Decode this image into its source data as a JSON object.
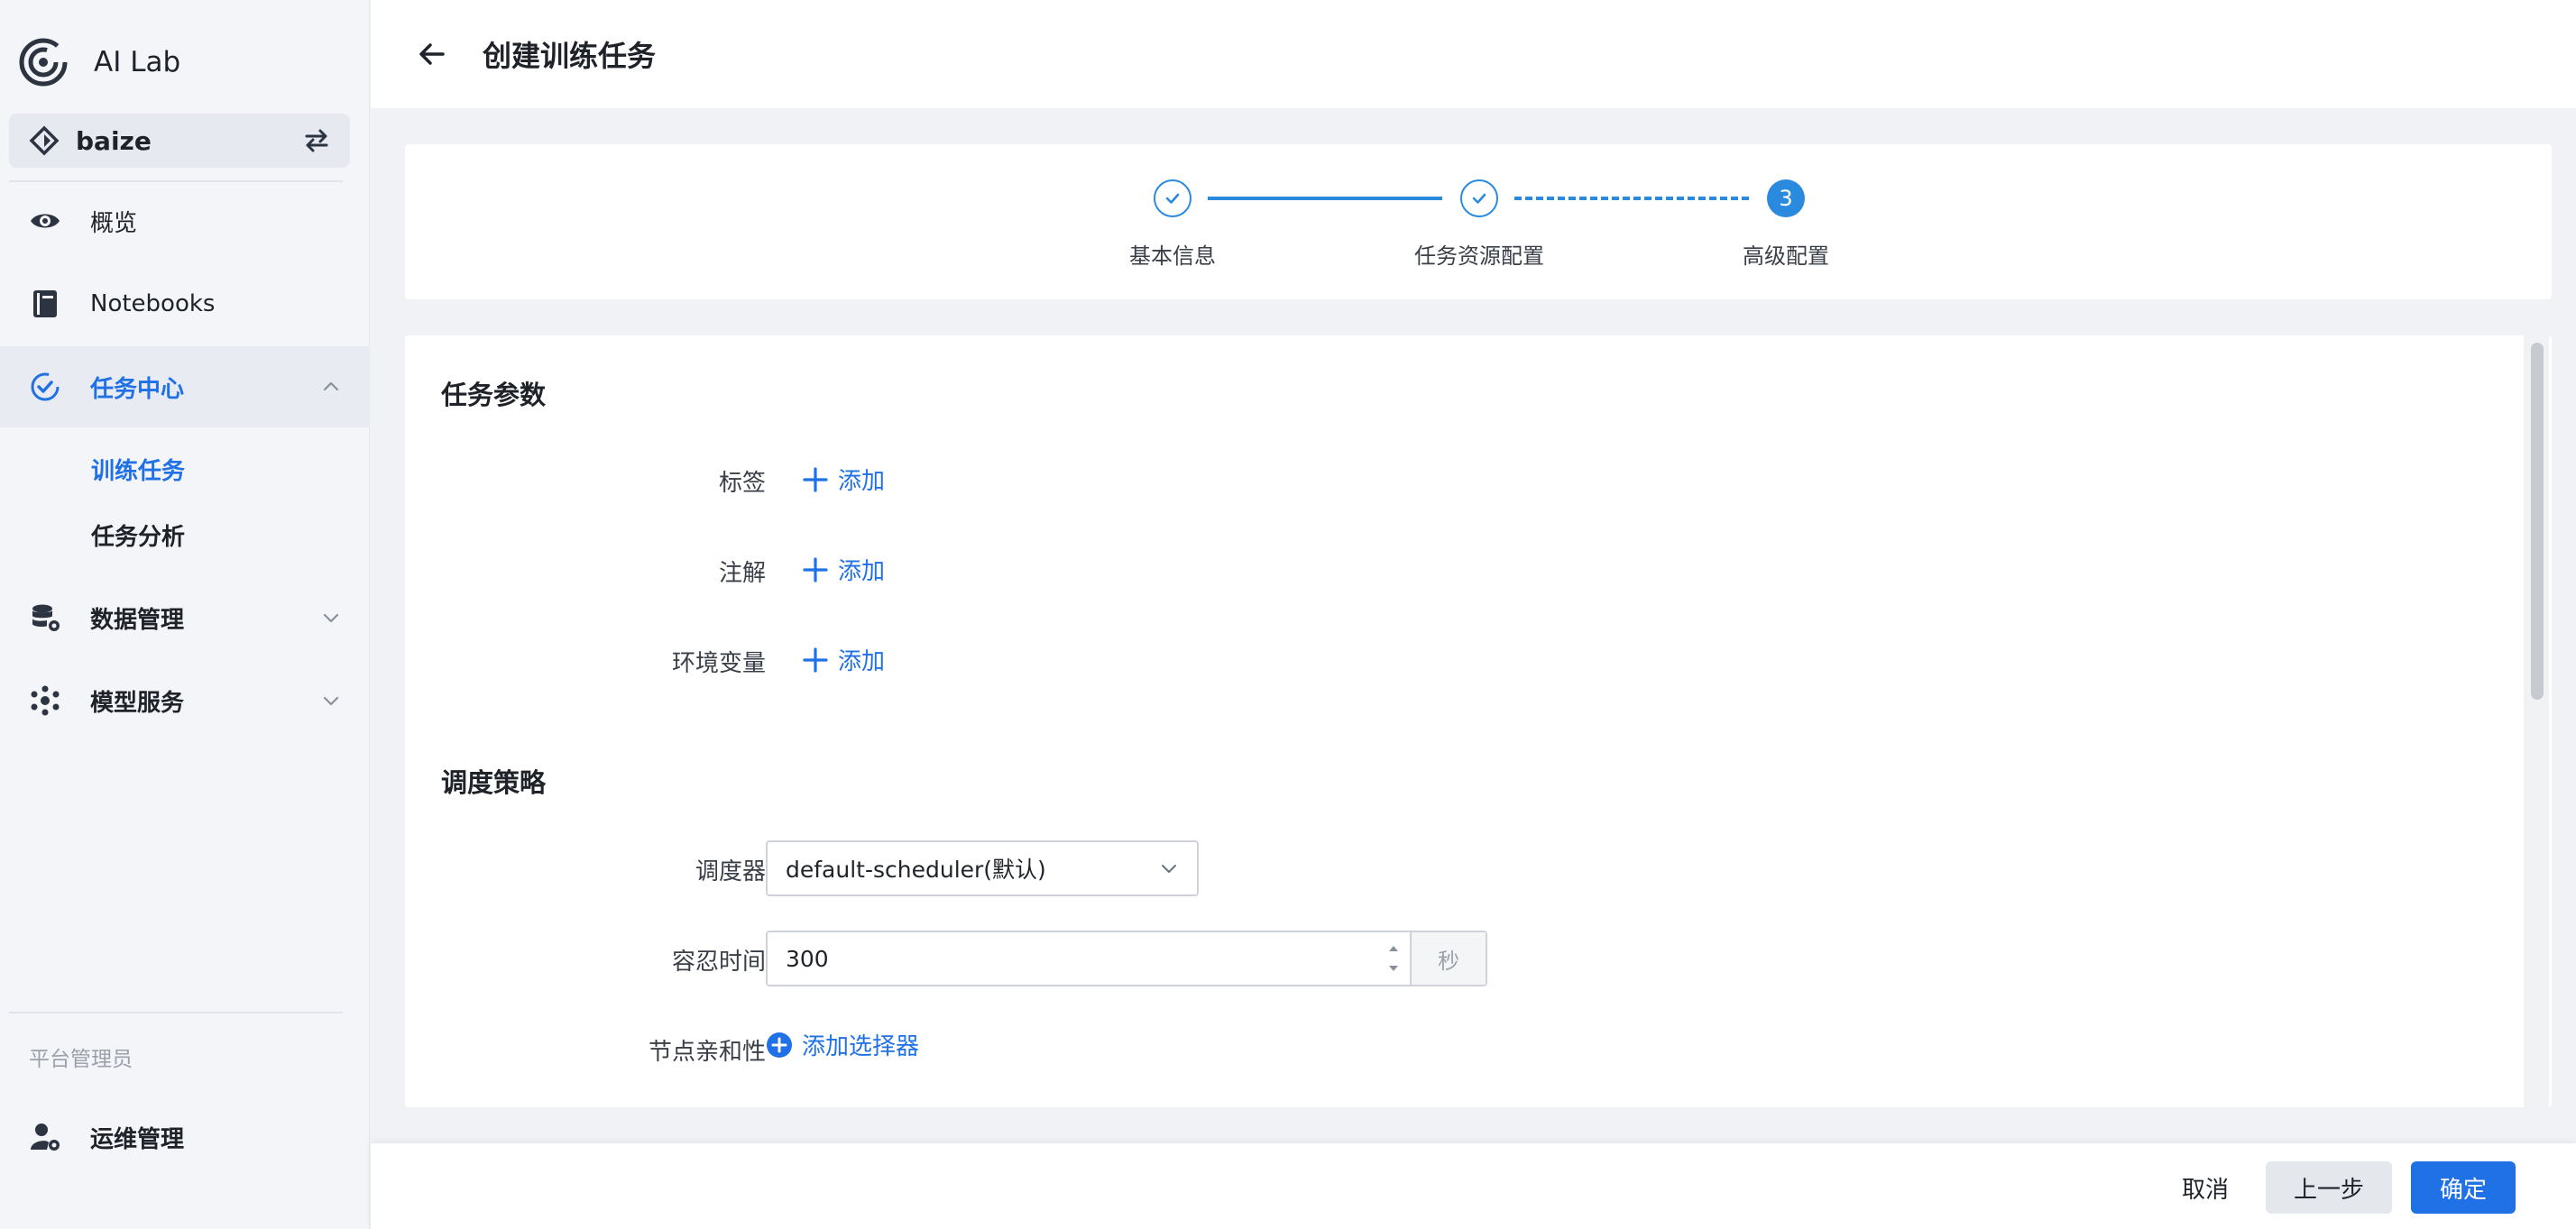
{
  "app": {
    "brand": "AI Lab",
    "workspace": "baize"
  },
  "colors": {
    "accent": "#2070e6",
    "step": "#2a8bde",
    "sidebar_bg": "#f4f5f8",
    "page_bg": "#f0f2f5"
  },
  "sidebar": {
    "items": [
      {
        "label": "概览",
        "icon": "eye-icon"
      },
      {
        "label": "Notebooks",
        "icon": "notebook-icon"
      },
      {
        "label": "任务中心",
        "icon": "task-check-icon",
        "active": true,
        "expanded": true,
        "children": [
          {
            "label": "训练任务",
            "active": true
          },
          {
            "label": "任务分析"
          }
        ]
      },
      {
        "label": "数据管理",
        "icon": "database-gear-icon"
      },
      {
        "label": "模型服务",
        "icon": "model-nodes-icon"
      }
    ],
    "section_caption": "平台管理员",
    "admin_item": {
      "label": "运维管理",
      "icon": "user-gear-icon"
    }
  },
  "header": {
    "title": "创建训练任务"
  },
  "steps": [
    {
      "label": "基本信息",
      "status": "done"
    },
    {
      "label": "任务资源配置",
      "status": "done"
    },
    {
      "label": "高级配置",
      "status": "current",
      "number": "3"
    }
  ],
  "form": {
    "section1_title": "任务参数",
    "labels_field": "标签",
    "annotations_field": "注解",
    "env_field": "环境变量",
    "add_label": "添加",
    "section2_title": "调度策略",
    "scheduler_label": "调度器",
    "scheduler_value": "default-scheduler(默认)",
    "toleration_label": "容忍时间",
    "toleration_value": "300",
    "toleration_unit": "秒",
    "affinity_label": "节点亲和性",
    "add_selector": "添加选择器"
  },
  "footer": {
    "cancel": "取消",
    "prev": "上一步",
    "confirm": "确定"
  }
}
